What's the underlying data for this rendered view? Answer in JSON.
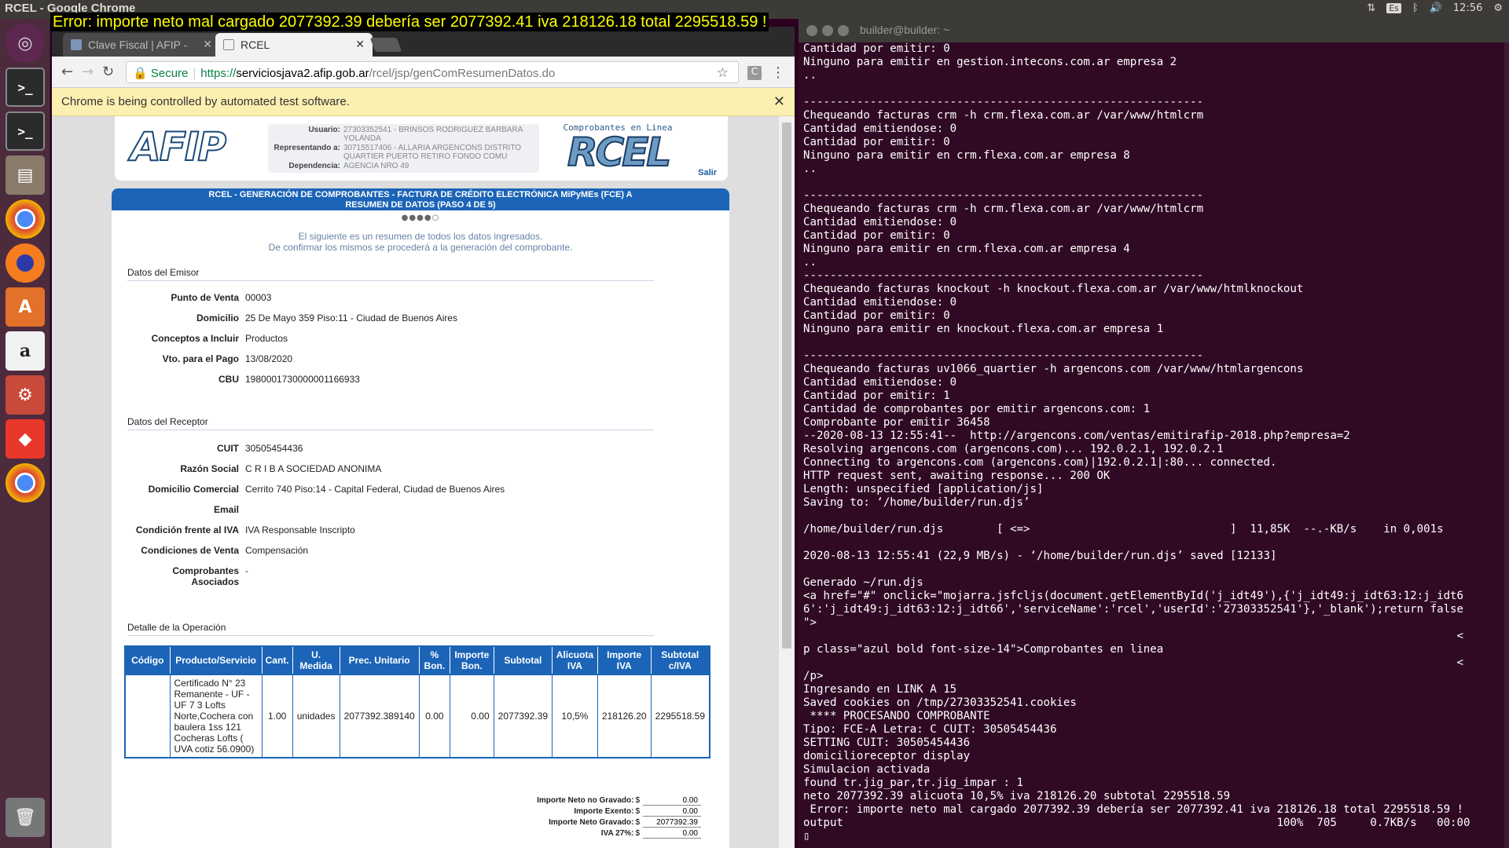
{
  "os": {
    "window_title": "RCEL - Google Chrome",
    "error_banner": "Error: importe neto mal cargado 2077392.39 debería ser 2077392.41 iva 218126.18 total 2295518.59 !",
    "keyboard_layout": "Es",
    "clock": "12:56",
    "launcher": [
      "dash-icon",
      "terminal-icon",
      "terminal-icon",
      "files-icon",
      "chrome-icon",
      "firefox-icon",
      "software-center-icon",
      "amazon-icon",
      "settings-icon",
      "anydesk-icon",
      "chrome-icon",
      "trash-icon"
    ]
  },
  "chrome": {
    "tabs": [
      {
        "label": "Clave Fiscal | AFIP - "
      },
      {
        "label": "RCEL"
      }
    ],
    "secure_label": "Secure",
    "url_proto": "https://",
    "url_host": "serviciosjava2.afip.gob.ar",
    "url_path": "/rcel/jsp/genComResumenDatos.do",
    "ext_label": "C",
    "infobar": "Chrome is being controlled by automated test software."
  },
  "page": {
    "afip_logo": "AFIP",
    "user": [
      {
        "k": "Usuario:",
        "v": "27303352541 - BRINSOS RODRIGUEZ BARBARA YOLANDA"
      },
      {
        "k": "Representando a:",
        "v": "30715517406 - ALLARIA ARGENCONS DISTRITO QUARTIER PUERTO RETIRO FONDO COMU"
      },
      {
        "k": "Dependencia:",
        "v": "AGENCIA NRO 49"
      }
    ],
    "rcel_caption": "Comprobantes en Linea",
    "rcel_logo": "RCEL",
    "salir": "Salir",
    "step_line1": "RCEL - GENERACIÓN DE COMPROBANTES - FACTURA DE CRÉDITO ELECTRÓNICA MiPyMEs (FCE) A",
    "step_line2": "RESUMEN DE DATOS (PASO 4 DE 5)",
    "intro_line1": "El siguiente es un resumen de todos los datos ingresados.",
    "intro_line2": "De confirmar los mismos se procederá a la generación del comprobante.",
    "emisor_title": "Datos del Emisor",
    "emisor": [
      {
        "k": "Punto de Venta",
        "v": "00003"
      },
      {
        "k": "Domicilio",
        "v": "25 De Mayo 359 Piso:11 - Ciudad de Buenos Aires"
      },
      {
        "k": "Conceptos a Incluir",
        "v": "Productos"
      },
      {
        "k": "Vto. para el Pago",
        "v": "13/08/2020"
      },
      {
        "k": "CBU",
        "v": "1980001730000001166933"
      }
    ],
    "receptor_title": "Datos del Receptor",
    "receptor": [
      {
        "k": "CUIT",
        "v": "30505454436"
      },
      {
        "k": "Razón Social",
        "v": "C R I B A SOCIEDAD ANONIMA"
      },
      {
        "k": "Domicilio Comercial",
        "v": "Cerrito 740 Piso:14 - Capital Federal, Ciudad de Buenos Aires"
      },
      {
        "k": "Email",
        "v": ""
      },
      {
        "k": "Condición frente al IVA",
        "v": "IVA Responsable Inscripto"
      },
      {
        "k": "Condiciones de Venta",
        "v": "Compensación"
      },
      {
        "k": "Comprobantes Asociados",
        "v": "-"
      }
    ],
    "operacion_title": "Detalle de la Operación",
    "table_headers": [
      "Código",
      "Producto/Servicio",
      "Cant.",
      "U. Medida",
      "Prec. Unitario",
      "% Bon.",
      "Importe Bon.",
      "Subtotal",
      "Alicuota IVA",
      "Importe IVA",
      "Subtotal c/IVA"
    ],
    "table_row": [
      "",
      "Certificado N° 23 Remanente - UF - UF 7 3 Lofts Norte,Cochera con baulera 1ss 121 Cocheras Lofts ( UVA cotiz 56.0900)",
      "1.00",
      "unidades",
      "2077392.389140",
      "0.00",
      "0.00",
      "2077392.39",
      "10,5%",
      "218126.20",
      "2295518.59"
    ],
    "totals": [
      {
        "k": "Importe Neto no Gravado:",
        "cur": "$",
        "v": "0.00"
      },
      {
        "k": "Importe Exento:",
        "cur": "$",
        "v": "0.00"
      },
      {
        "k": "Importe Neto Gravado:",
        "cur": "$",
        "v": "2077392.39"
      },
      {
        "k": "IVA 27%:",
        "cur": "$",
        "v": "0.00"
      }
    ]
  },
  "terminal": {
    "title": "builder@builder: ~",
    "lines": [
      "Cantidad por emitir: 0",
      "Ninguno para emitir en gestion.intecons.com.ar empresa 2",
      "..",
      "",
      "------------------------------------------------------------",
      "Chequeando facturas crm -h crm.flexa.com.ar /var/www/htmlcrm",
      "Cantidad emitiendose: 0",
      "Cantidad por emitir: 0",
      "Ninguno para emitir en crm.flexa.com.ar empresa 8",
      "..",
      "",
      "------------------------------------------------------------",
      "Chequeando facturas crm -h crm.flexa.com.ar /var/www/htmlcrm",
      "Cantidad emitiendose: 0",
      "Cantidad por emitir: 0",
      "Ninguno para emitir en crm.flexa.com.ar empresa 4",
      "..",
      "------------------------------------------------------------",
      "Chequeando facturas knockout -h knockout.flexa.com.ar /var/www/htmlknockout",
      "Cantidad emitiendose: 0",
      "Cantidad por emitir: 0",
      "Ninguno para emitir en knockout.flexa.com.ar empresa 1",
      "",
      "------------------------------------------------------------",
      "Chequeando facturas uv1066_quartier -h argencons.com /var/www/htmlargencons",
      "Cantidad emitiendose: 0",
      "Cantidad por emitir: 1",
      "Cantidad de comprobantes por emitir argencons.com: 1",
      "Comprobante por emitir 36458",
      "--2020-08-13 12:55:41--  http://argencons.com/ventas/emitirafip-2018.php?empresa=2",
      "Resolving argencons.com (argencons.com)... 192.0.2.1, 192.0.2.1",
      "Connecting to argencons.com (argencons.com)|192.0.2.1|:80... connected.",
      "HTTP request sent, awaiting response... 200 OK",
      "Length: unspecified [application/js]",
      "Saving to: ‘/home/builder/run.djs’",
      "",
      "/home/builder/run.djs        [ <=>                              ]  11,85K  --.-KB/s    in 0,001s",
      "",
      "2020-08-13 12:55:41 (22,9 MB/s) - ‘/home/builder/run.djs’ saved [12133]",
      "",
      "Generado ~/run.djs",
      "<a href=\"#\" onclick=\"mojarra.jsfcljs(document.getElementById('j_idt49'),{'j_idt49:j_idt63:12:j_idt6",
      "6':'j_idt49:j_idt63:12:j_idt66','serviceName':'rcel','userId':'27303352541'},'_blank');return false",
      "\">",
      "                                                                                                  <",
      "p class=\"azul bold font-size-14\">Comprobantes en linea",
      "                                                                                                  <",
      "/p>",
      "Ingresando en LINK A 15",
      "Saved cookies on /tmp/27303352541.cookies",
      " **** PROCESANDO COMPROBANTE",
      "Tipo: FCE-A Letra: C CUIT: 30505454436",
      "SETTING CUIT: 30505454436",
      "domicilioreceptor display",
      "Simulacion activada",
      "found tr.jig_par,tr.jig_impar : 1",
      "neto 2077392.39 alicuota 10,5% iva 218126.20 subtotal 2295518.59",
      " Error: importe neto mal cargado 2077392.39 debería ser 2077392.41 iva 218126.18 total 2295518.59 !",
      "output                                                                 100%  705     0.7KB/s   00:00",
      "▯"
    ]
  }
}
